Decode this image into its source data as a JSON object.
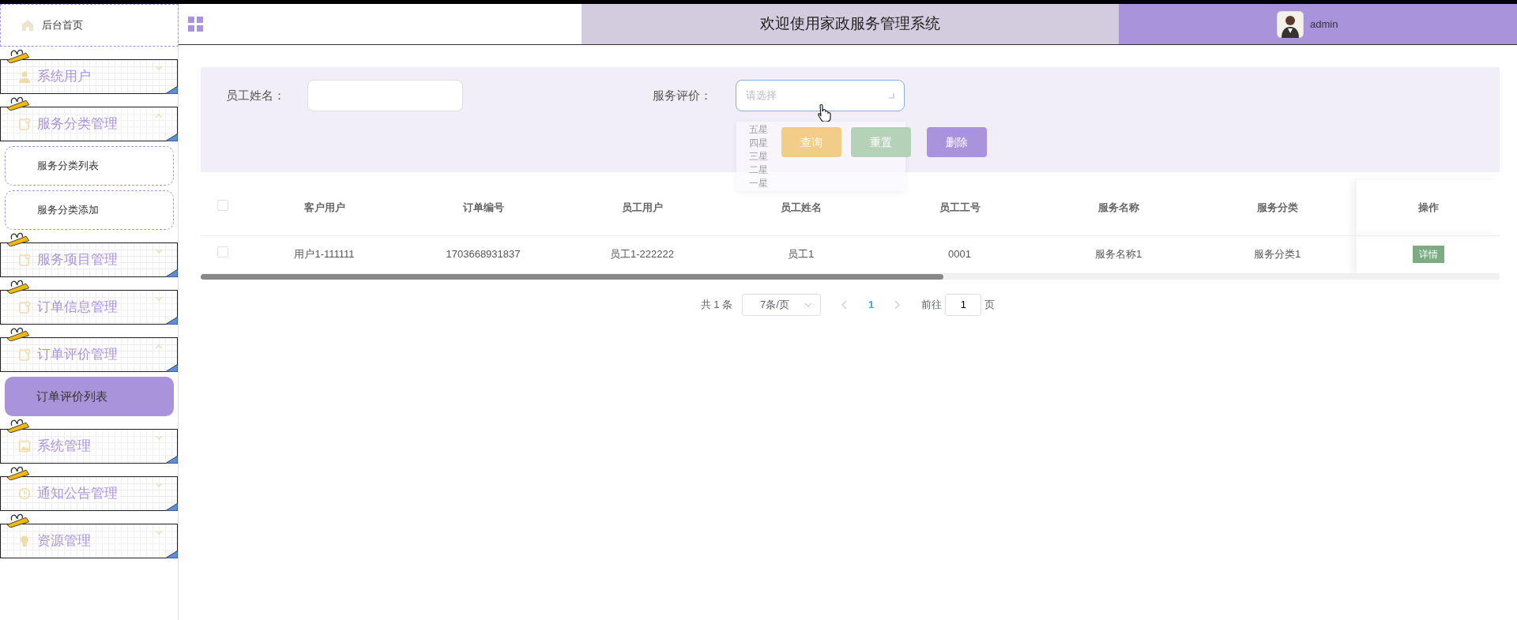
{
  "sidebar": {
    "items": [
      {
        "label": "后台首页",
        "kind": "home"
      },
      {
        "label": "系统用户",
        "kind": "menu",
        "expanded": false
      },
      {
        "label": "服务分类管理",
        "kind": "menu",
        "expanded": true,
        "children": [
          {
            "label": "服务分类列表",
            "selected": false
          },
          {
            "label": "服务分类添加",
            "selected": false
          }
        ]
      },
      {
        "label": "服务项目管理",
        "kind": "menu",
        "expanded": false
      },
      {
        "label": "订单信息管理",
        "kind": "menu",
        "expanded": false
      },
      {
        "label": "订单评价管理",
        "kind": "menu",
        "expanded": true,
        "children": [
          {
            "label": "订单评价列表",
            "selected": true
          }
        ]
      },
      {
        "label": "系统管理",
        "kind": "menu",
        "expanded": false
      },
      {
        "label": "通知公告管理",
        "kind": "menu",
        "expanded": false
      },
      {
        "label": "资源管理",
        "kind": "menu",
        "expanded": false
      }
    ]
  },
  "header": {
    "title": "欢迎使用家政服务管理系统",
    "user": "admin"
  },
  "filters": [
    {
      "label": "员工姓名：",
      "kind": "input"
    },
    {
      "label": "服务评价：",
      "kind": "select",
      "placeholder": "请选择",
      "open": true,
      "options": [
        "五星",
        "四星",
        "三星",
        "二星",
        "一星"
      ]
    }
  ],
  "buttons": [
    {
      "label": "查询",
      "kind": "query"
    },
    {
      "label": "重置",
      "kind": "reset"
    },
    {
      "label": "删除",
      "kind": "delete"
    }
  ],
  "table": {
    "select_all_checked": false,
    "columns": [
      "客户用户",
      "订单编号",
      "员工用户",
      "员工姓名",
      "员工工号",
      "服务名称",
      "服务分类",
      "操作"
    ],
    "rows": [
      {
        "checked": false,
        "cells": [
          "用户1-111111",
          "1703668931837",
          "员工1-222222",
          "员工1",
          "0001",
          "服务名称1",
          "服务分类1"
        ],
        "action": "详情"
      }
    ]
  },
  "pagination": {
    "total": "共 1 条",
    "page_size": "7条/页",
    "pages": [
      {
        "label": "1",
        "selected": true
      }
    ],
    "goto_label": "前往",
    "goto_value": "1",
    "page_suffix": "页"
  }
}
